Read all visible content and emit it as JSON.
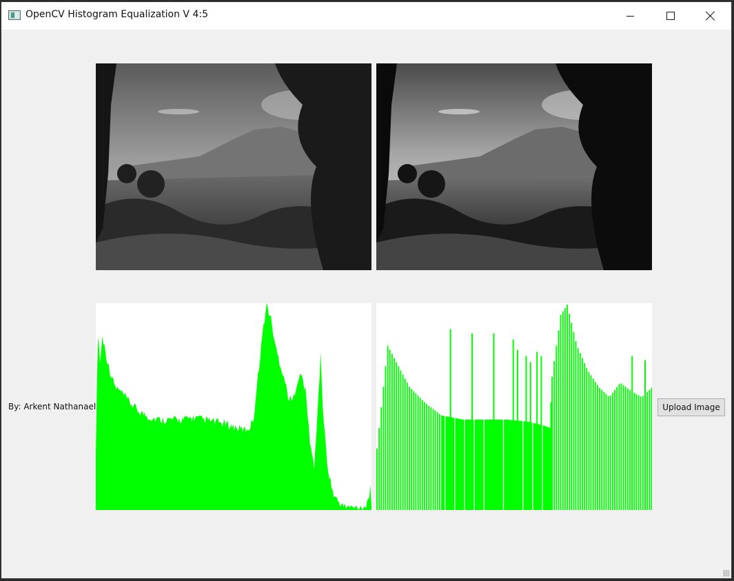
{
  "window": {
    "title": "OpenCV Histogram Equalization V 4:5",
    "icon": "app-icon"
  },
  "controls": {
    "minimize": "minimize-icon",
    "maximize": "maximize-icon",
    "close": "close-icon"
  },
  "footer": {
    "author": "By: Arkent Nathanael",
    "upload_label": "Upload Image"
  },
  "images": {
    "original": "grayscale landscape photo (original)",
    "equalized": "grayscale landscape photo (equalized)"
  },
  "colors": {
    "histogram": "#00ff00",
    "background": "#f0f0f0"
  },
  "histograms": {
    "original": [
      [
        0,
        0.3
      ],
      [
        2,
        0.86
      ],
      [
        4,
        0.72
      ],
      [
        6,
        0.84
      ],
      [
        8,
        0.8
      ],
      [
        10,
        0.74
      ],
      [
        14,
        0.66
      ],
      [
        18,
        0.6
      ],
      [
        24,
        0.57
      ],
      [
        32,
        0.52
      ],
      [
        40,
        0.48
      ],
      [
        50,
        0.45
      ],
      [
        60,
        0.44
      ],
      [
        70,
        0.44
      ],
      [
        80,
        0.44
      ],
      [
        90,
        0.45
      ],
      [
        100,
        0.44
      ],
      [
        110,
        0.43
      ],
      [
        120,
        0.42
      ],
      [
        130,
        0.4
      ],
      [
        138,
        0.39
      ],
      [
        142,
        0.4
      ],
      [
        146,
        0.45
      ],
      [
        150,
        0.65
      ],
      [
        154,
        0.85
      ],
      [
        158,
        1.0
      ],
      [
        162,
        0.93
      ],
      [
        166,
        0.8
      ],
      [
        170,
        0.72
      ],
      [
        174,
        0.65
      ],
      [
        178,
        0.55
      ],
      [
        182,
        0.53
      ],
      [
        186,
        0.62
      ],
      [
        190,
        0.66
      ],
      [
        194,
        0.58
      ],
      [
        198,
        0.34
      ],
      [
        202,
        0.2
      ],
      [
        206,
        0.56
      ],
      [
        208,
        0.75
      ],
      [
        210,
        0.5
      ],
      [
        214,
        0.22
      ],
      [
        220,
        0.07
      ],
      [
        228,
        0.02
      ],
      [
        240,
        0.01
      ],
      [
        250,
        0.02
      ],
      [
        254,
        0.1
      ],
      [
        255,
        0.0
      ]
    ],
    "equalized": {
      "envelope": [
        [
          0,
          0.3
        ],
        [
          10,
          0.8
        ],
        [
          20,
          0.7
        ],
        [
          30,
          0.6
        ],
        [
          45,
          0.52
        ],
        [
          60,
          0.46
        ],
        [
          80,
          0.44
        ],
        [
          100,
          0.44
        ],
        [
          120,
          0.44
        ],
        [
          140,
          0.43
        ],
        [
          155,
          0.41
        ],
        [
          160,
          0.4
        ],
        [
          162,
          0.65
        ],
        [
          170,
          0.95
        ],
        [
          176,
          1.0
        ],
        [
          185,
          0.8
        ],
        [
          195,
          0.68
        ],
        [
          205,
          0.6
        ],
        [
          215,
          0.55
        ],
        [
          225,
          0.62
        ],
        [
          235,
          0.58
        ],
        [
          245,
          0.55
        ],
        [
          255,
          0.6
        ]
      ],
      "spikes": [
        [
          68,
          0.88
        ],
        [
          88,
          0.86
        ],
        [
          108,
          0.86
        ],
        [
          126,
          0.83
        ],
        [
          130,
          0.78
        ],
        [
          138,
          0.75
        ],
        [
          142,
          0.72
        ],
        [
          148,
          0.77
        ],
        [
          152,
          0.75
        ],
        [
          236,
          0.75
        ],
        [
          248,
          0.73
        ]
      ]
    }
  }
}
